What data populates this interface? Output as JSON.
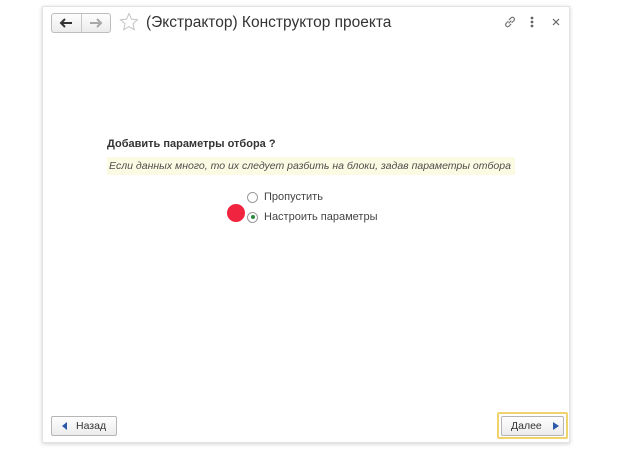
{
  "window": {
    "title": "(Экстрактор) Конструктор проекта",
    "icons": [
      "arrow-left-icon",
      "arrow-right-icon",
      "star-icon",
      "link-icon",
      "more-vertical-icon",
      "close-icon"
    ]
  },
  "content": {
    "question": "Добавить параметры отбора ?",
    "hint": "Если данных много, то их следует разбить на блоки, задав параметры отбора",
    "options": [
      {
        "label": "Пропустить",
        "selected": false
      },
      {
        "label": "Настроить параметры",
        "selected": true
      }
    ]
  },
  "footer": {
    "back_label": "Назад",
    "next_label": "Далее"
  },
  "colors": {
    "accent_frame": "#f1d36e",
    "hint_background": "#fbfbe3",
    "radio_selected": "#2a8a3e",
    "click_marker": "#f0243f"
  }
}
